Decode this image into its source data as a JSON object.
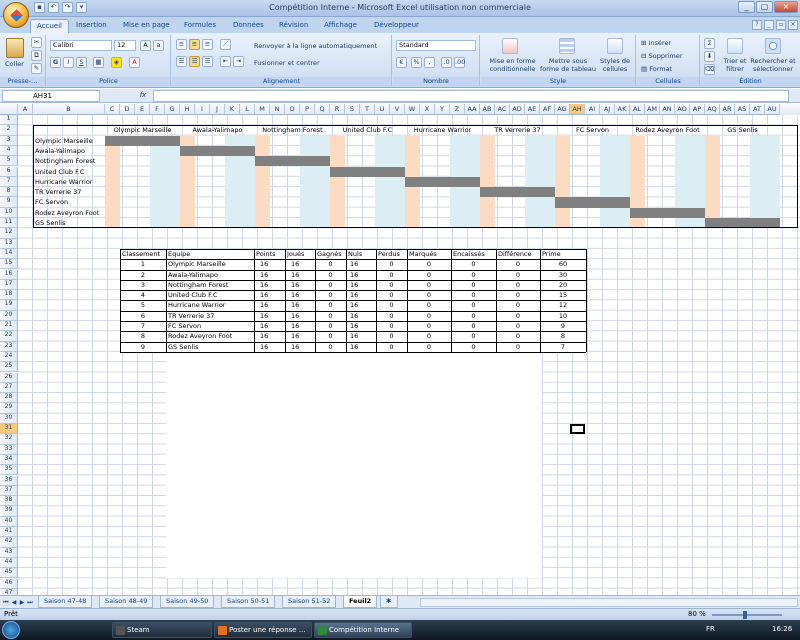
{
  "window": {
    "title": "Compétition Interne - Microsoft Excel utilisation non commerciale",
    "controls": [
      "_",
      "▢",
      "×"
    ]
  },
  "ribbon": {
    "tabs": [
      "Accueil",
      "Insertion",
      "Mise en page",
      "Formules",
      "Données",
      "Révision",
      "Affichage",
      "Développeur"
    ],
    "active_tab": "Accueil",
    "paste_label": "Coller",
    "clipboard_label": "Presse-...",
    "font_name": "Calibri",
    "font_size": "12",
    "police_label": "Police",
    "wrap_text": "Renvoyer à la ligne automatiquement",
    "merge_center": "Fusionner et centrer",
    "alignment_label": "Alignement",
    "number_format": "Standard",
    "nombre_label": "Nombre",
    "cond_format": "Mise en forme conditionnelle",
    "table_format": "Mettre sous forme de tableau",
    "cell_styles": "Styles de cellules",
    "style_label": "Style",
    "insert": "Insérer",
    "delete": "Supprimer",
    "format": "Format",
    "cells_label": "Cellules",
    "sort_filter": "Trier et filtrer",
    "find_select": "Rechercher et sélectionner",
    "edition_label": "Édition"
  },
  "formula_bar": {
    "name_box": "AH31",
    "fx": "fx",
    "content": ""
  },
  "columns": [
    "A",
    "B",
    "C",
    "D",
    "E",
    "F",
    "G",
    "H",
    "I",
    "J",
    "K",
    "L",
    "M",
    "N",
    "O",
    "P",
    "Q",
    "R",
    "S",
    "T",
    "U",
    "V",
    "W",
    "X",
    "Y",
    "Z",
    "AA",
    "AB",
    "AC",
    "AD",
    "AE",
    "AF",
    "AG",
    "AH",
    "AI",
    "AJ",
    "AK",
    "AL",
    "AM",
    "AN",
    "AO",
    "AP",
    "AQ",
    "AR",
    "AS",
    "AT",
    "AU"
  ],
  "selected_column": "AH",
  "selected_row": 31,
  "matrix": {
    "teams_header": [
      "Olympic Marseille",
      "Awala-Yalimapo",
      "Nottingham Forest",
      "United Club F.C",
      "Hurricane Warrior",
      "TR Verrerie 37",
      "FC Servon",
      "Rodez Aveyron Foot",
      "GS Senlis"
    ],
    "rows": [
      "Olympic Marseille",
      "Awala-Yalimapo",
      "Nottingham Forest",
      "United Club F.C",
      "Hurricane Warrior",
      "TR Verrerie 37",
      "FC Servon",
      "Rodez Aveyron Foot",
      "GS Senlis"
    ]
  },
  "standings": {
    "headers": [
      "Classement",
      "Equipe",
      "Points",
      "Joués",
      "Gagnés",
      "Nuls",
      "Perdus",
      "Marqués",
      "Encaissés",
      "Différence",
      "Prime"
    ],
    "rows": [
      [
        "1",
        "Olympic Marseille",
        "16",
        "16",
        "0",
        "16",
        "0",
        "0",
        "0",
        "0",
        "60"
      ],
      [
        "2",
        "Awala-Yalimapo",
        "16",
        "16",
        "0",
        "16",
        "0",
        "0",
        "0",
        "0",
        "30"
      ],
      [
        "3",
        "Nottingham Forest",
        "16",
        "16",
        "0",
        "16",
        "0",
        "0",
        "0",
        "0",
        "20"
      ],
      [
        "4",
        "United Club F.C",
        "16",
        "16",
        "0",
        "16",
        "0",
        "0",
        "0",
        "0",
        "15"
      ],
      [
        "5",
        "Hurricane Warrior",
        "16",
        "16",
        "0",
        "16",
        "0",
        "0",
        "0",
        "0",
        "12"
      ],
      [
        "6",
        "TR Verrerie 37",
        "16",
        "16",
        "0",
        "16",
        "0",
        "0",
        "0",
        "0",
        "10"
      ],
      [
        "7",
        "FC Servon",
        "16",
        "16",
        "0",
        "16",
        "0",
        "0",
        "0",
        "0",
        "9"
      ],
      [
        "8",
        "Rodez Aveyron Foot",
        "16",
        "16",
        "0",
        "16",
        "0",
        "0",
        "0",
        "0",
        "8"
      ],
      [
        "9",
        "GS Senlis",
        "16",
        "16",
        "0",
        "16",
        "0",
        "0",
        "0",
        "0",
        "7"
      ]
    ]
  },
  "sheets": [
    "Saison 47-48",
    "Saison 48-49",
    "Saison 49-50",
    "Saison 50-51",
    "Saison 51-52",
    "Feuil2"
  ],
  "active_sheet": "Feuil2",
  "status": {
    "ready": "Prêt",
    "zoom": "80 %"
  },
  "taskbar": {
    "items": [
      "Steam",
      "Poster une réponse ...",
      "Compétition Interne"
    ],
    "lang": "FR",
    "clock": "16:26"
  }
}
